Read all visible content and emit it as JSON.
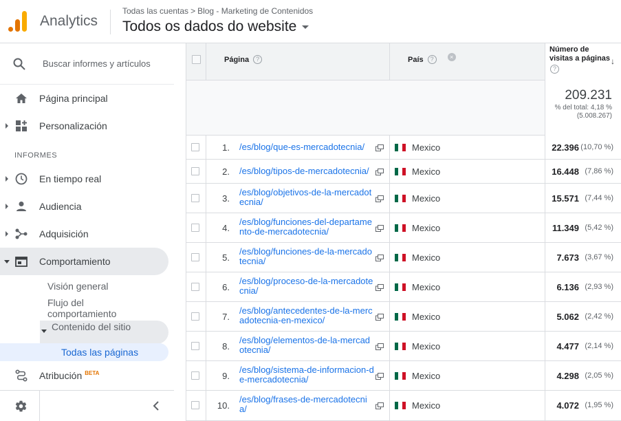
{
  "header": {
    "app_name": "Analytics",
    "breadcrumb": {
      "account": "Todas las cuentas",
      "separator": ">",
      "property": "Blog - Marketing de Contenidos"
    },
    "view_name": "Todos os dados do website"
  },
  "sidebar": {
    "search_placeholder": "Buscar informes y artículos",
    "home": "Página principal",
    "customization": "Personalización",
    "reports_section": "INFORMES",
    "realtime": "En tiempo real",
    "audience": "Audiencia",
    "acquisition": "Adquisición",
    "behavior": "Comportamiento",
    "behavior_sub": {
      "overview": "Visión general",
      "flow": "Flujo del comportamiento",
      "site_content": "Contenido del sitio",
      "all_pages": "Todas las páginas"
    },
    "attribution": "Atribución",
    "attribution_badge": "BETA"
  },
  "table": {
    "columns": {
      "page": "Página",
      "country": "País",
      "metric": "Número de visitas a páginas",
      "help_glyph": "?",
      "remove_glyph": "×",
      "sort_glyph": "↓"
    },
    "totals": {
      "value": "209.231",
      "pct_line": "% del total: 4,18 %",
      "total_line": "(5.008.267)"
    },
    "rows": [
      {
        "rank": "1.",
        "page": "/es/blog/que-es-mercadotecnia/",
        "country": "Mexico",
        "value": "22.396",
        "pct": "(10,70 %)"
      },
      {
        "rank": "2.",
        "page": "/es/blog/tipos-de-mercadotecnia/",
        "country": "Mexico",
        "value": "16.448",
        "pct": "(7,86 %)"
      },
      {
        "rank": "3.",
        "page": "/es/blog/objetivos-de-la-mercadotecnia/",
        "country": "Mexico",
        "value": "15.571",
        "pct": "(7,44 %)"
      },
      {
        "rank": "4.",
        "page": "/es/blog/funciones-del-departamento-de-mercadotecnia/",
        "country": "Mexico",
        "value": "11.349",
        "pct": "(5,42 %)"
      },
      {
        "rank": "5.",
        "page": "/es/blog/funciones-de-la-mercadotecnia/",
        "country": "Mexico",
        "value": "7.673",
        "pct": "(3,67 %)"
      },
      {
        "rank": "6.",
        "page": "/es/blog/proceso-de-la-mercadotecnia/",
        "country": "Mexico",
        "value": "6.136",
        "pct": "(2,93 %)"
      },
      {
        "rank": "7.",
        "page": "/es/blog/antecedentes-de-la-mercadotecnia-en-mexico/",
        "country": "Mexico",
        "value": "5.062",
        "pct": "(2,42 %)"
      },
      {
        "rank": "8.",
        "page": "/es/blog/elementos-de-la-mercadotecnia/",
        "country": "Mexico",
        "value": "4.477",
        "pct": "(2,14 %)"
      },
      {
        "rank": "9.",
        "page": "/es/blog/sistema-de-informacion-de-mercadotecnia/",
        "country": "Mexico",
        "value": "4.298",
        "pct": "(2,05 %)"
      },
      {
        "rank": "10.",
        "page": "/es/blog/frases-de-mercadotecnia/",
        "country": "Mexico",
        "value": "4.072",
        "pct": "(1,95 %)"
      }
    ]
  },
  "colors": {
    "accent": "#1a73e8",
    "logo_dark": "#e37400",
    "logo_light": "#f9ab00",
    "flag_green": "#006847",
    "flag_white": "#ffffff",
    "flag_red": "#ce1126"
  }
}
